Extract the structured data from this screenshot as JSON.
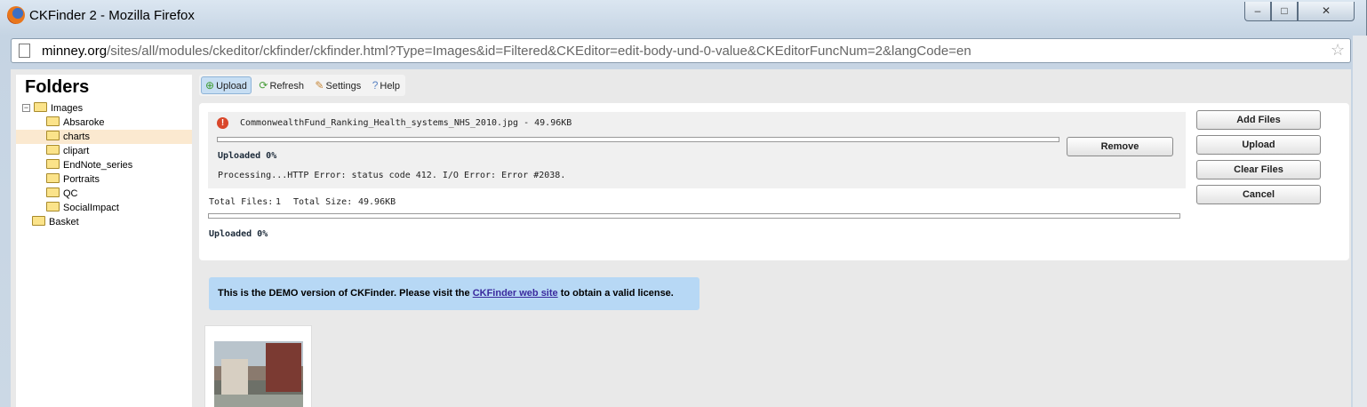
{
  "window": {
    "title": "CKFinder 2 - Mozilla Firefox",
    "controls": {
      "minimize": "–",
      "maximize": "□",
      "close": "✕"
    }
  },
  "address": {
    "host": "minney.org",
    "path": "/sites/all/modules/ckeditor/ckfinder/ckfinder.html?Type=Images&id=Filtered&CKEditor=edit-body-und-0-value&CKEditorFuncNum=2&langCode=en"
  },
  "sidebar": {
    "title": "Folders",
    "root": "Images",
    "children": [
      "Absaroke",
      "charts",
      "clipart",
      "EndNote_series",
      "Portraits",
      "QC",
      "SocialImpact"
    ],
    "selected": "charts",
    "other_root": "Basket"
  },
  "toolbar": {
    "upload": "Upload",
    "refresh": "Refresh",
    "settings": "Settings",
    "help": "Help"
  },
  "upload_panel": {
    "file_name": "CommonwealthFund_Ranking_Health_systems_NHS_2010.jpg - 49.96KB",
    "file_progress_fraction": 0,
    "file_status": "Uploaded 0%",
    "file_error": "Processing...HTTP Error: status code 412. I/O Error: Error #2038.",
    "remove_label": "Remove",
    "total_files_label": "Total Files:",
    "total_files": "1",
    "total_size_label": "Total Size:",
    "total_size": "49.96KB",
    "total_progress_fraction": 0,
    "total_status": "Uploaded 0%",
    "buttons": {
      "add_files": "Add Files",
      "upload": "Upload",
      "clear_files": "Clear Files",
      "cancel": "Cancel"
    }
  },
  "demo_notice": {
    "before": "This is the DEMO version of CKFinder. Please visit the ",
    "link": "CKFinder web site",
    "after": " to obtain a valid license."
  }
}
